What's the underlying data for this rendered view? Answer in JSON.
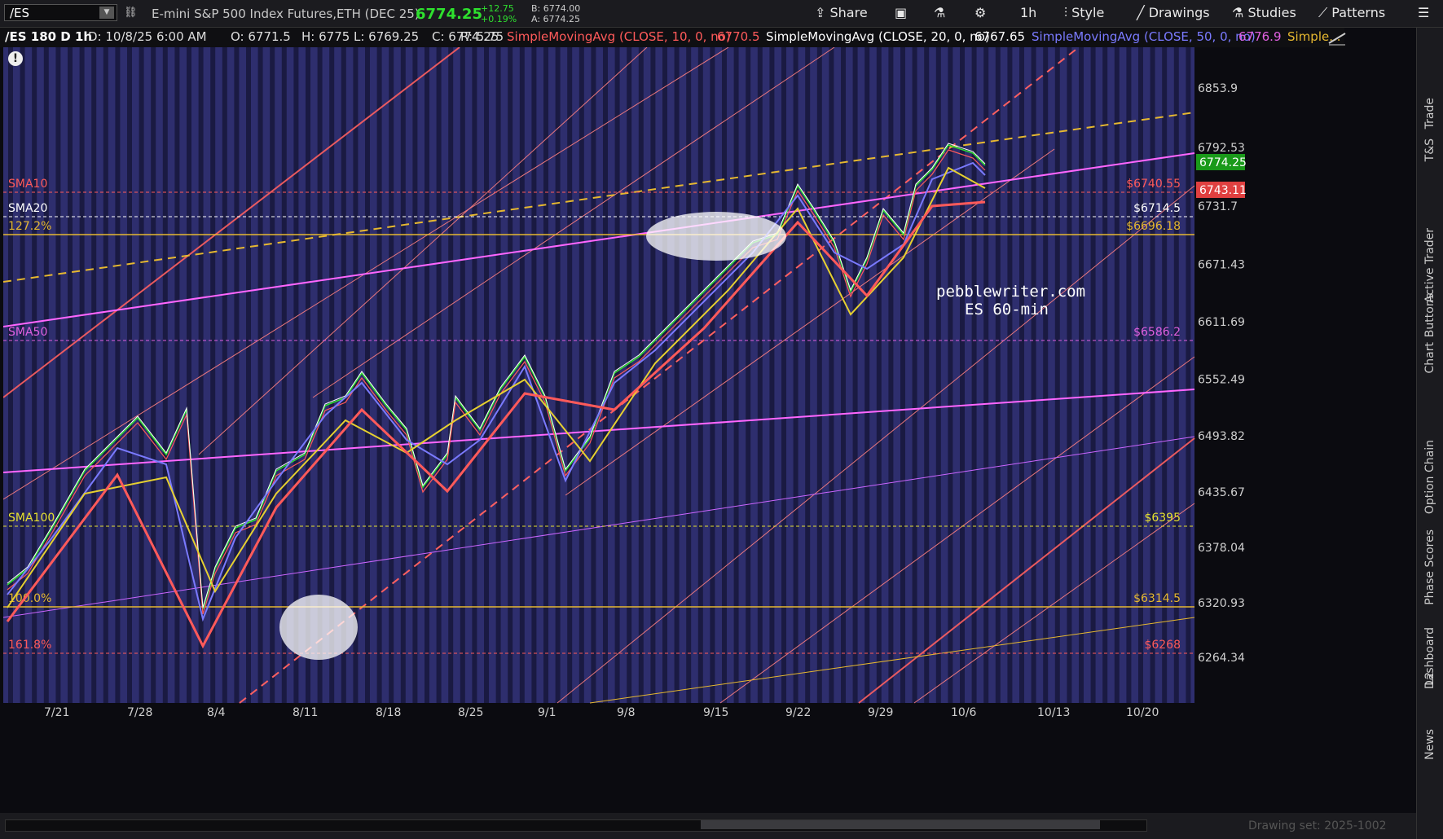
{
  "toolbar": {
    "symbol": "/ES",
    "description": "E-mini S&P 500 Index Futures,ETH (DEC 25)",
    "last": "6774.25",
    "change": "+12.75",
    "change_pct": "+0.19%",
    "bid": "B: 6774.00",
    "ask": "A: 6774.25",
    "share": "Share",
    "timeframe": "1h",
    "style": "Style",
    "drawings": "Drawings",
    "studies": "Studies",
    "patterns": "Patterns"
  },
  "studybar": {
    "chart_id": "/ES 180 D 1h",
    "date": "D: 10/8/25 6:00 AM",
    "open": "O: 6771.5",
    "high": "H: 6775",
    "low": "L: 6769.25",
    "close": "C: 6774.25",
    "range": "R: 5.75",
    "sma10_label": "SimpleMovingAvg (CLOSE, 10, 0, no)",
    "sma10_value": "6770.5",
    "sma20_label": "SimpleMovingAvg (CLOSE, 20, 0, no)",
    "sma20_value": "6767.65",
    "sma50_label": "SimpleMovingAvg (CLOSE, 50, 0, no)",
    "sma50_value": "6776.9",
    "more": "Simple..."
  },
  "chart": {
    "watermark_line1": "pebblewriter.com",
    "watermark_line2": "ES 60-min",
    "price_axis": [
      "6853.9",
      "6792.53",
      "6731.7",
      "6671.43",
      "6611.69",
      "6552.49",
      "6493.82",
      "6435.67",
      "6378.04",
      "6320.93",
      "6264.34"
    ],
    "price_tag_last": "6774.25",
    "price_tag_red": "6743.11",
    "date_axis": [
      "7/21",
      "7/28",
      "8/4",
      "8/11",
      "8/18",
      "8/25",
      "9/1",
      "9/8",
      "9/15",
      "9/22",
      "9/29",
      "10/6",
      "10/13",
      "10/20"
    ],
    "levels": [
      {
        "left": "SMA10",
        "right": "$6740.55",
        "color": "#ff5a5a"
      },
      {
        "left": "SMA20",
        "right": "$6714.5",
        "color": "#ffffff"
      },
      {
        "left": "127.2%",
        "right": "$6696.18",
        "color": "#e6b830"
      },
      {
        "left": "SMA50",
        "right": "$6586.2",
        "color": "#e060e0"
      },
      {
        "left": "SMA100",
        "right": "$6395",
        "color": "#e6e030"
      },
      {
        "left": "100.0%",
        "right": "$6314.5",
        "color": "#e6b830"
      },
      {
        "left": "161.8%",
        "right": "$6268",
        "color": "#ff5a5a"
      }
    ]
  },
  "sidebar": {
    "tabs": [
      "Trade",
      "T&S",
      "Active Trader",
      "Buttons",
      "Chart",
      "Option Chain",
      "Phase Scores",
      "Dashboard",
      "L2",
      "News"
    ]
  },
  "footer": {
    "drawing_set": "Drawing set: 2025-1002"
  },
  "colors": {
    "up": "#2ee02e",
    "down": "#ff5a5a",
    "sma50": "#e060e0",
    "gold": "#e6b830"
  }
}
